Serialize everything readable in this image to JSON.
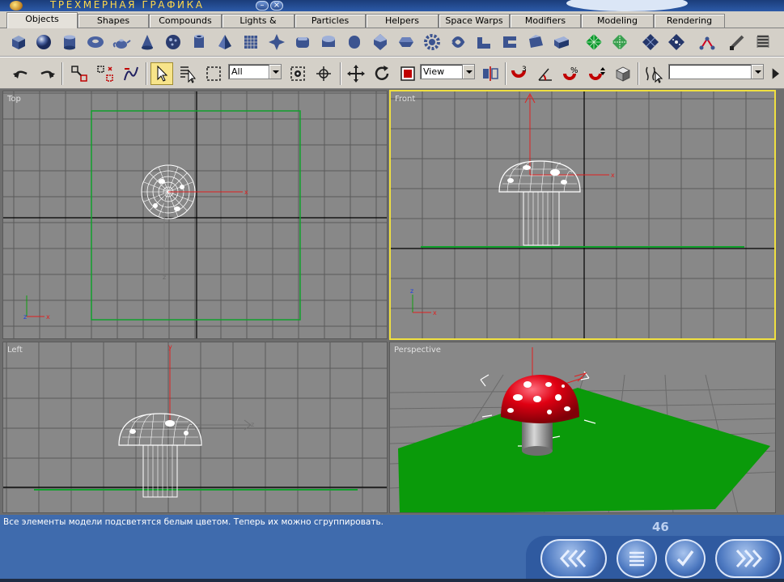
{
  "window": {
    "title": "ТРЕХМЕРНАЯ ГРАФИКА"
  },
  "tabs": [
    {
      "label": "Objects",
      "active": true
    },
    {
      "label": "Shapes",
      "active": false
    },
    {
      "label": "Compounds",
      "active": false
    },
    {
      "label": "Lights & Cameras",
      "active": false
    },
    {
      "label": "Particles",
      "active": false
    },
    {
      "label": "Helpers",
      "active": false
    },
    {
      "label": "Space Warps",
      "active": false
    },
    {
      "label": "Modifiers",
      "active": false
    },
    {
      "label": "Modeling",
      "active": false
    },
    {
      "label": "Rendering",
      "active": false
    }
  ],
  "create_toolbar": {
    "icons": [
      "box-icon",
      "sphere-icon",
      "cylinder-icon",
      "torus-icon",
      "teapot-icon",
      "cone-icon",
      "geosphere-icon",
      "tube-icon",
      "pyramid-icon",
      "plane-icon",
      "hedra-icon",
      "chamfer-box-icon",
      "oil-tank-icon",
      "capsule-icon",
      "spindle-icon",
      "gengon-icon",
      "gear-icon",
      "torus-knot-icon",
      "l-ext-icon",
      "c-ext-icon",
      "prism-icon",
      "patch-grid-icon",
      "tri-patch-icon",
      "nurbs-surface-icon",
      "nurbs-cv-icon",
      "boolean-icon",
      "loft-icon",
      "spring-icon"
    ]
  },
  "main_toolbar": {
    "selection_filter": "All",
    "reference_coord_system": "View",
    "named_selection_set": "",
    "icons": [
      "undo-icon",
      "redo-icon",
      "select-and-link-icon",
      "unlink-icon",
      "bind-space-warp-icon",
      "select-object-icon",
      "select-by-name-icon",
      "selection-region-icon",
      "use-pivot-center-icon",
      "select-manipulate-icon",
      "select-move-icon",
      "select-rotate-icon",
      "select-scale-icon",
      "mirror-icon",
      "snap-3d-icon",
      "angle-snap-icon",
      "percent-snap-icon",
      "spinner-snap-icon",
      "material-editor-icon",
      "named-selection-icon"
    ]
  },
  "viewports": [
    {
      "id": "top",
      "label": "Top",
      "active": false
    },
    {
      "id": "front",
      "label": "Front",
      "active": true
    },
    {
      "id": "left",
      "label": "Left",
      "active": false
    },
    {
      "id": "perspective",
      "label": "Perspective",
      "active": false
    }
  ],
  "axis_labels": {
    "x": "x",
    "y": "y",
    "z": "z"
  },
  "status": {
    "message": "Все элементы модели подсветятся белым цветом. Теперь их можно сгруппировать.",
    "page": "46"
  },
  "colors": {
    "viewport_bg": "#888888",
    "grid": "#5a5a5a",
    "active_border": "#f0e040",
    "ground": "#0a9a0a",
    "mushroom_cap": "#e00012",
    "status_bg": "#3f6bad"
  }
}
